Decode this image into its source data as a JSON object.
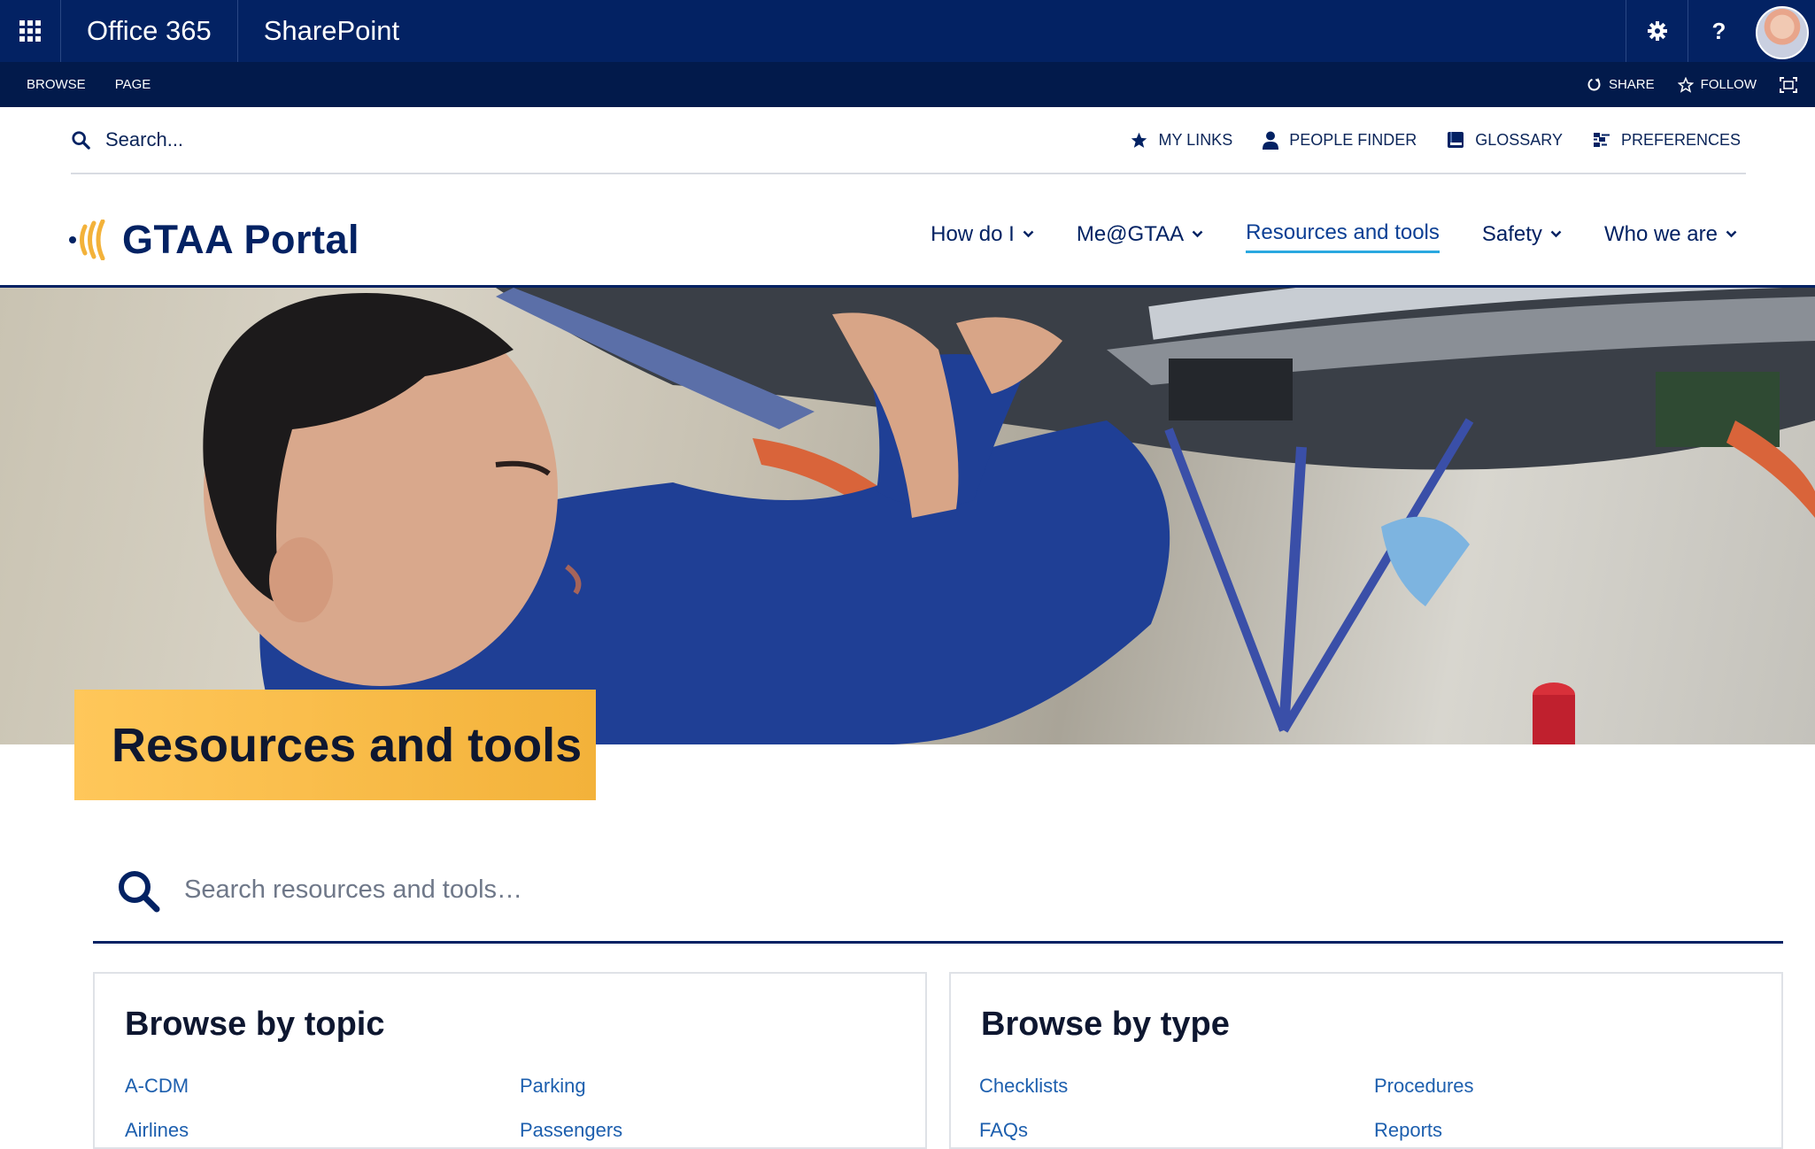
{
  "suite": {
    "office_label": "Office 365",
    "app_label": "SharePoint",
    "help_label": "?"
  },
  "ribbon": {
    "browse_label": "BROWSE",
    "page_label": "PAGE",
    "share_label": "SHARE",
    "follow_label": "FOLLOW"
  },
  "utility": {
    "search_placeholder": "Search...",
    "links": [
      {
        "label": "MY LINKS",
        "icon": "star-icon"
      },
      {
        "label": "PEOPLE FINDER",
        "icon": "person-icon"
      },
      {
        "label": "GLOSSARY",
        "icon": "book-icon"
      },
      {
        "label": "PREFERENCES",
        "icon": "sliders-icon"
      }
    ]
  },
  "header": {
    "portal_title": "GTAA Portal",
    "nav": [
      {
        "label": "How do I",
        "dropdown": true
      },
      {
        "label": "Me@GTAA",
        "dropdown": true
      },
      {
        "label": "Resources and tools",
        "dropdown": false,
        "active": true
      },
      {
        "label": "Safety",
        "dropdown": true
      },
      {
        "label": "Who we are",
        "dropdown": true
      }
    ]
  },
  "hero": {
    "title": "Resources and tools"
  },
  "resource_search": {
    "placeholder": "Search resources and tools…"
  },
  "browse_topic": {
    "title": "Browse by topic",
    "col1": [
      "A-CDM",
      "Airlines"
    ],
    "col2": [
      "Parking",
      "Passengers"
    ]
  },
  "browse_type": {
    "title": "Browse by type",
    "col1": [
      "Checklists",
      "FAQs"
    ],
    "col2": [
      "Procedures",
      "Reports"
    ]
  },
  "colors": {
    "suite_bar": "#032263",
    "ribbon": "#021a4b",
    "accent_yellow": "#f3b23a",
    "active_underline": "#2aa8e0",
    "link_blue": "#1d5fae"
  }
}
